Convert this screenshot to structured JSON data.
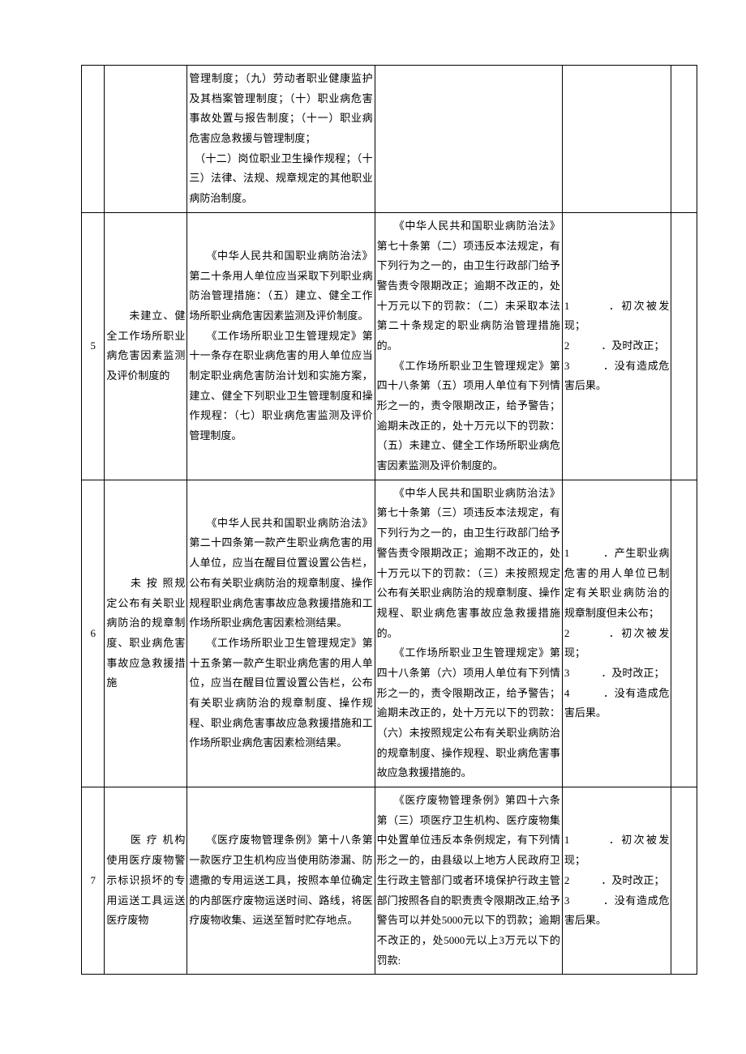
{
  "rows": [
    {
      "num": "",
      "name": "",
      "basis": "管理制度；（九）劳动者职业健康监护及其档案管理制度；（十）职业病危害事故处置与报告制度；（十一）职业病危害应急救援与管理制度；\n　（十二）岗位职业卫生操作规程；（十三）法律、法规、规章规定的其他职业病防治制度。",
      "penalty": "",
      "factors": "",
      "extra": ""
    },
    {
      "num": "5",
      "name": "　　未建立、健全工作场所职业病危害因素监测及评价制度的",
      "basis": "　　《中华人民共和国职业病防治法》第二十条用人单位应当采取下列职业病防治管理措施：（五）建立、健全工作场所职业病危害因素监测及评价制度。\n　　《工作场所职业卫生管理规定》第十一条存在职业病危害的用人单位应当制定职业病危害防治计划和实施方案，建立、健全下列职业卫生管理制度和操作规程：（七）职业病危害监测及评价管理制度。",
      "penalty": "　　《中华人民共和国职业病防治法》第七十条第（二）项违反本法规定，有下列行为之一的，由卫生行政部门给予警告责令限期改正；逾期不改正的，处十万元以下的罚款：（二）未采取本法第二十条规定的职业病防治管理措施的。\n　　《工作场所职业卫生管理规定》第四十八条第（五）项用人单位有下列情形之一的，责令限期改正，给予警告；逾期未改正的，处十万元以下的罚款：（五）未建立、健全工作场所职业病危害因素监测及评价制度的。",
      "factors": "1　　　．初次被发现；\n2　　　．及时改正；\n3　　　．没有造成危害后果。",
      "extra": ""
    },
    {
      "num": "6",
      "name": "　　未 按 照规定公布有关职业病防治的规章制度、职业病危害事故应急救援措施",
      "basis": "　　《中华人民共和国职业病防治法》第二十四条第一款产生职业病危害的用人单位，应当在醒目位置设置公告栏，公布有关职业病防治的规章制度、操作规程职业病危害事故应急救援措施和工作场所职业病危害因素检测结果。\n　　《工作场所职业卫生管理规定》第十五条第一款产生职业病危害的用人单位，应当在醒目位置设置公告栏，公布有关职业病防治的规章制度、操作规程、职业病危害事故应急救援措施和工作场所职业病危害因素检测结果。",
      "penalty": "　　《中华人民共和国职业病防治法》第七十条第（三）项违反本法规定，有下列行为之一的，由卫生行政部门给予警告责令限期改正；逾期不改正的，处十万元以下的罚款：（三）未按照规定公布有关职业病防治的规章制度、操作规程、职业病危害事故应急救援措施的。\n　　《工作场所职业卫生管理规定》第四十八条第（六）项用人单位有下列情形之一的，责令限期改正，给予警告；逾期未改正的，处十万元以下的罚款：（六）未按照规定公布有关职业病防治的规章制度、操作规程、职业病危害事故应急救援措施的。",
      "factors": "1　　　．产生职业病危害的用人单位已制定有关职业病防治的规章制度但未公布；\n2　　　．初次被发现；\n3　　　．及时改正；\n4　　　．没有造成危害后果。",
      "extra": ""
    },
    {
      "num": "7",
      "name": "　　医 疗 机构使用医疗废物警示标识损坏的专用运送工具运送医疗废物",
      "basis": "　　《医疗废物管理条例》第十八条第一款医疗卫生机构应当使用防渗漏、防遗撒的专用运送工具，按照本单位确定的内部医疗废物运送时间、路线，将医疗废物收集、运送至暂时贮存地点。",
      "penalty": "　　《医疗废物管理条例》第四十六条第（三）项医疗卫生机构、医疗废物集中处置单位违反本条例规定，有下列情形之一的，由县级以上地方人民政府卫生行政主管部门或者环境保护行政主管部门按照各自的职责责令限期改正,给予警告可以并处5000元以下的罚款；逾期不改正的，处5000元以上3万元以下的罚款:",
      "factors": "1　　　．初次被发现；\n2　　　．及时改正；\n3　　　．没有造成危害后果。",
      "extra": ""
    }
  ]
}
